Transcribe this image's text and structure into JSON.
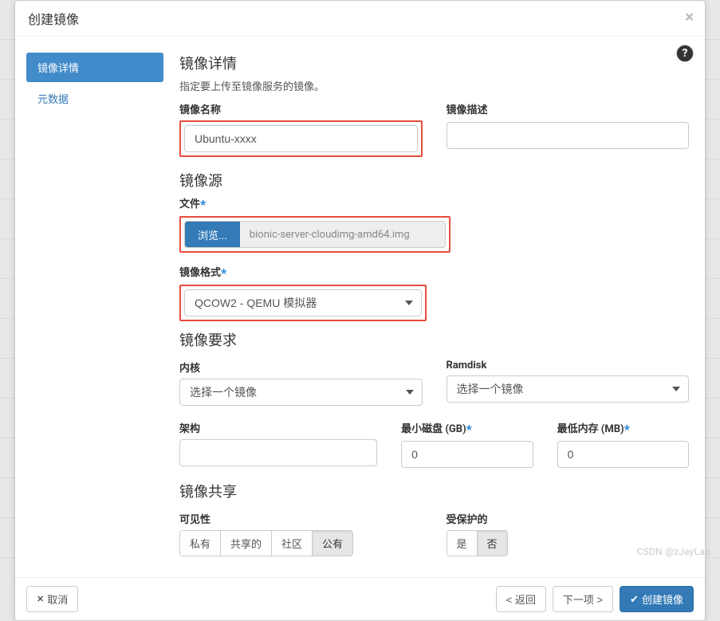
{
  "modal": {
    "title": "创建镜像"
  },
  "sidebar": {
    "items": [
      {
        "label": "镜像详情",
        "active": true
      },
      {
        "label": "元数据",
        "active": false
      }
    ]
  },
  "details": {
    "section_title": "镜像详情",
    "section_desc": "指定要上传至镜像服务的镜像。",
    "name_label": "镜像名称",
    "name_value": "Ubuntu-xxxx",
    "desc_label": "镜像描述",
    "desc_value": ""
  },
  "source": {
    "section_title": "镜像源",
    "file_label": "文件",
    "browse_label": "浏览...",
    "file_name": "bionic-server-cloudimg-amd64.img",
    "format_label": "镜像格式",
    "format_value": "QCOW2 - QEMU 模拟器"
  },
  "requirements": {
    "section_title": "镜像要求",
    "kernel_label": "内核",
    "kernel_value": "选择一个镜像",
    "ramdisk_label": "Ramdisk",
    "ramdisk_value": "选择一个镜像",
    "arch_label": "架构",
    "arch_value": "",
    "min_disk_label": "最小磁盘 (GB)",
    "min_disk_value": "0",
    "min_ram_label": "最低内存 (MB)",
    "min_ram_value": "0"
  },
  "sharing": {
    "section_title": "镜像共享",
    "visibility_label": "可见性",
    "visibility_options": [
      "私有",
      "共享的",
      "社区",
      "公有"
    ],
    "visibility_selected": "公有",
    "protected_label": "受保护的",
    "protected_options": [
      "是",
      "否"
    ],
    "protected_selected": "否"
  },
  "footer": {
    "cancel": "取消",
    "back": "< 返回",
    "next": "下一项 >",
    "submit": "创建镜像"
  },
  "watermark": "CSDN @zJayLao"
}
